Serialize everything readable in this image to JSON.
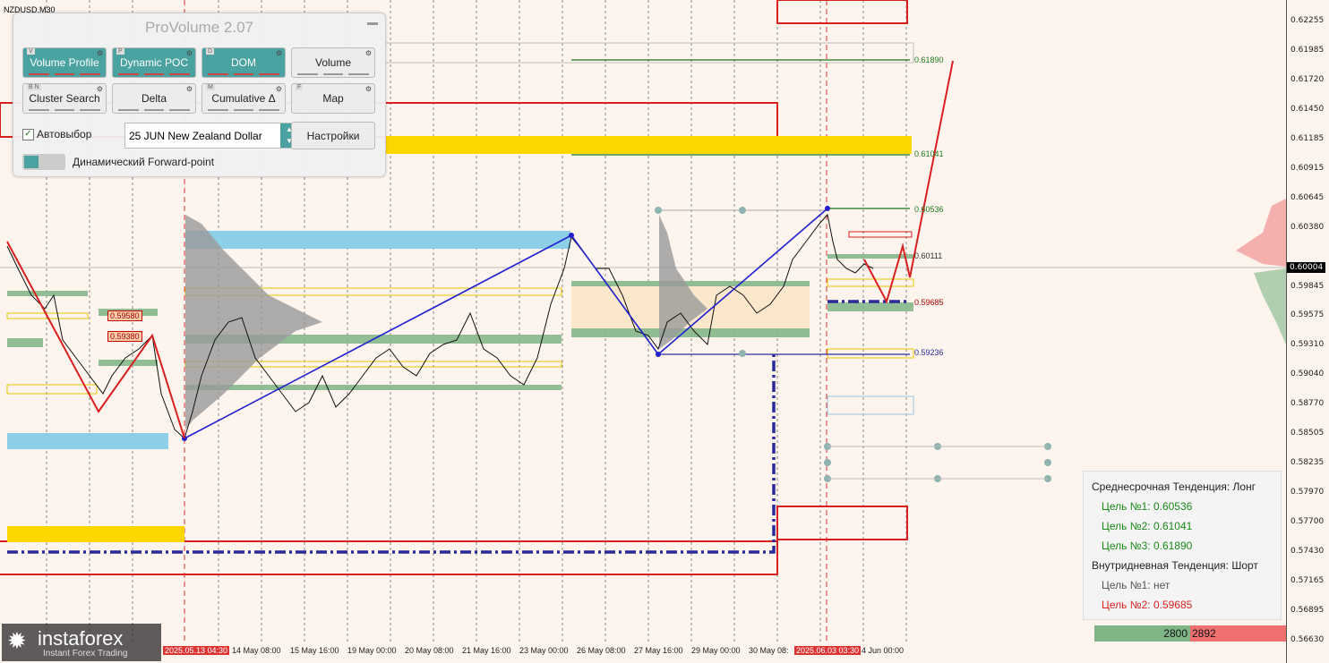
{
  "symbol": "NZDUSD,M30",
  "panel": {
    "title": "ProVolume 2.07",
    "buttons": [
      {
        "key": "V",
        "label": "Volume Profile",
        "active": true
      },
      {
        "key": "P",
        "label": "Dynamic POC",
        "active": true
      },
      {
        "key": "D",
        "label": "DOM",
        "active": true
      },
      {
        "key": "",
        "label": "Volume",
        "active": false
      },
      {
        "key": "B N",
        "label": "Cluster Search",
        "active": false
      },
      {
        "key": "",
        "label": "Delta",
        "active": false
      },
      {
        "key": "M",
        "label": "Cumulative Δ",
        "active": false
      },
      {
        "key": "F",
        "label": "Map",
        "active": false
      }
    ],
    "autoselect_label": "Автовыбор",
    "instrument_value": "25 JUN New Zealand Dollar",
    "settings_label": "Настройки",
    "forward_point_label": "Динамический Forward-point"
  },
  "price_axis": [
    "0.62255",
    "0.61985",
    "0.61720",
    "0.61450",
    "0.61185",
    "0.60915",
    "0.60645",
    "0.60380",
    "0.60004",
    "0.59845",
    "0.59575",
    "0.59310",
    "0.59040",
    "0.58770",
    "0.58505",
    "0.58235",
    "0.57970",
    "0.57700",
    "0.57430",
    "0.57165",
    "0.56895",
    "0.56630"
  ],
  "current_price": "0.60004",
  "level_labels": {
    "t3": "0.61890",
    "t2": "0.61041",
    "t1": "0.60536",
    "a": "0.60111",
    "s1": "0.59685",
    "s2": "0.59236"
  },
  "red_tags": [
    "0.59580",
    "0.59380"
  ],
  "dates": [
    "14 May 08:00",
    "15 May 16:00",
    "19 May 00:00",
    "20 May 08:00",
    "21 May 16:00",
    "23 May 00:00",
    "26 May 08:00",
    "27 May 16:00",
    "29 May 00:00",
    "30 May 08:",
    " 4 Jun 00:00"
  ],
  "date_highlights": [
    "2025.05.13 04:30",
    "2025.06.03 03:30"
  ],
  "info": {
    "mid_trend": "Среднесрочная Тенденция: Лонг",
    "mid_targets": [
      "Цель №1: 0.60536",
      "Цель №2: 0.61041",
      "Цель №3: 0.61890"
    ],
    "intraday_trend": "Внутридневная Тенденция: Шорт",
    "intraday_targets": [
      "Цель №1: нет",
      "Цель №2: 0.59685"
    ]
  },
  "volumes": {
    "buy": "2800",
    "sell": "2892"
  },
  "logo": {
    "brand": "instaforex",
    "tagline": "Instant Forex Trading"
  },
  "colors": {
    "background": "#fdf4ee",
    "teal": "#4aa3a0",
    "blue_line": "#1f1fcf",
    "red_line": "#d92020",
    "gold": "#ffd700",
    "sky": "#8ecfe8",
    "green_zone": "#7fb486"
  }
}
